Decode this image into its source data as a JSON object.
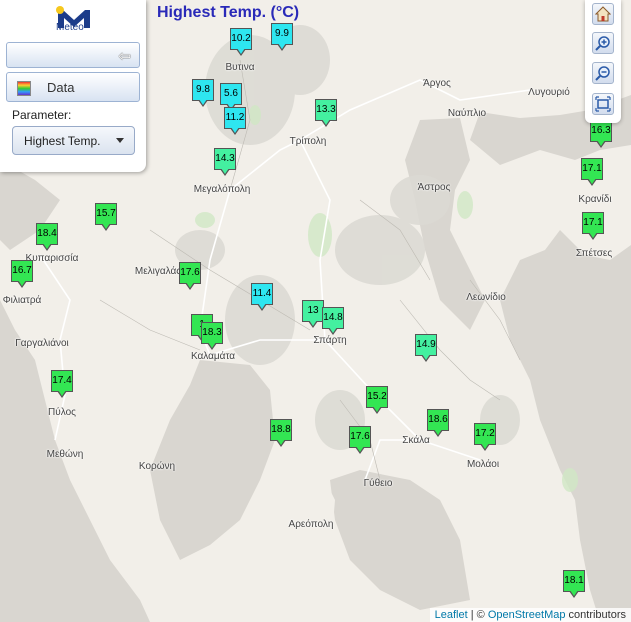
{
  "header": {
    "title": "Highest Temp. (°C)"
  },
  "panel": {
    "logo_text": "Meteo",
    "data_label": "Data",
    "parameter_label": "Parameter:",
    "parameter_value": "Highest Temp."
  },
  "toolbar": {
    "home_icon": "home-icon",
    "zoom_in_icon": "zoom-in-icon",
    "zoom_out_icon": "zoom-out-icon",
    "extent_icon": "full-extent-icon"
  },
  "attribution": {
    "leaflet": "Leaflet",
    "sep": " | © ",
    "osm": "OpenStreetMap",
    "suffix": " contributors"
  },
  "colors": {
    "cold": "#2ee6f0",
    "mid": "#44f0a0",
    "warm": "#33e653",
    "title": "#2929b8"
  },
  "places": [
    "Βυτινα",
    "Άργος",
    "Ναύπλιο",
    "Λυγουριό",
    "Τρίπολη",
    "Μεγαλόπολη",
    "Άστρος",
    "Κρανίδι",
    "Σπέτσες",
    "Κυπαρισσία",
    "Μελιγαλάς",
    "Φιλιατρά",
    "Γαργαλιάνοι",
    "Καλαμάτα",
    "Σπάρτη",
    "Λεωνίδιο",
    "Πύλος",
    "Μεθώνη",
    "Κορώνη",
    "Σκάλα",
    "Μολάοι",
    "Γύθειο",
    "Αρεόπολη"
  ],
  "stations": [
    {
      "value": "10.2",
      "tier": "cold"
    },
    {
      "value": "9.9",
      "tier": "cold"
    },
    {
      "value": "9.8",
      "tier": "cold"
    },
    {
      "value": "5.6",
      "tier": "cold"
    },
    {
      "value": "11.2",
      "tier": "cold"
    },
    {
      "value": "13.3",
      "tier": "mid"
    },
    {
      "value": "16.3",
      "tier": "warm"
    },
    {
      "value": "14.3",
      "tier": "mid"
    },
    {
      "value": "17.1",
      "tier": "warm"
    },
    {
      "value": "15.7",
      "tier": "warm"
    },
    {
      "value": "18.4",
      "tier": "warm"
    },
    {
      "value": "17.1",
      "tier": "warm"
    },
    {
      "value": "16.7",
      "tier": "warm"
    },
    {
      "value": "17.6",
      "tier": "warm"
    },
    {
      "value": "11.4",
      "tier": "cold"
    },
    {
      "value": "13",
      "tier": "mid"
    },
    {
      "value": "14.8",
      "tier": "mid"
    },
    {
      "value": "1",
      "tier": "warm"
    },
    {
      "value": "18.3",
      "tier": "warm"
    },
    {
      "value": "14.9",
      "tier": "mid"
    },
    {
      "value": "17.4",
      "tier": "warm"
    },
    {
      "value": "15.2",
      "tier": "warm"
    },
    {
      "value": "18.6",
      "tier": "warm"
    },
    {
      "value": "18.8",
      "tier": "warm"
    },
    {
      "value": "17.6",
      "tier": "warm"
    },
    {
      "value": "17.2",
      "tier": "warm"
    },
    {
      "value": "18.1",
      "tier": "warm"
    }
  ]
}
